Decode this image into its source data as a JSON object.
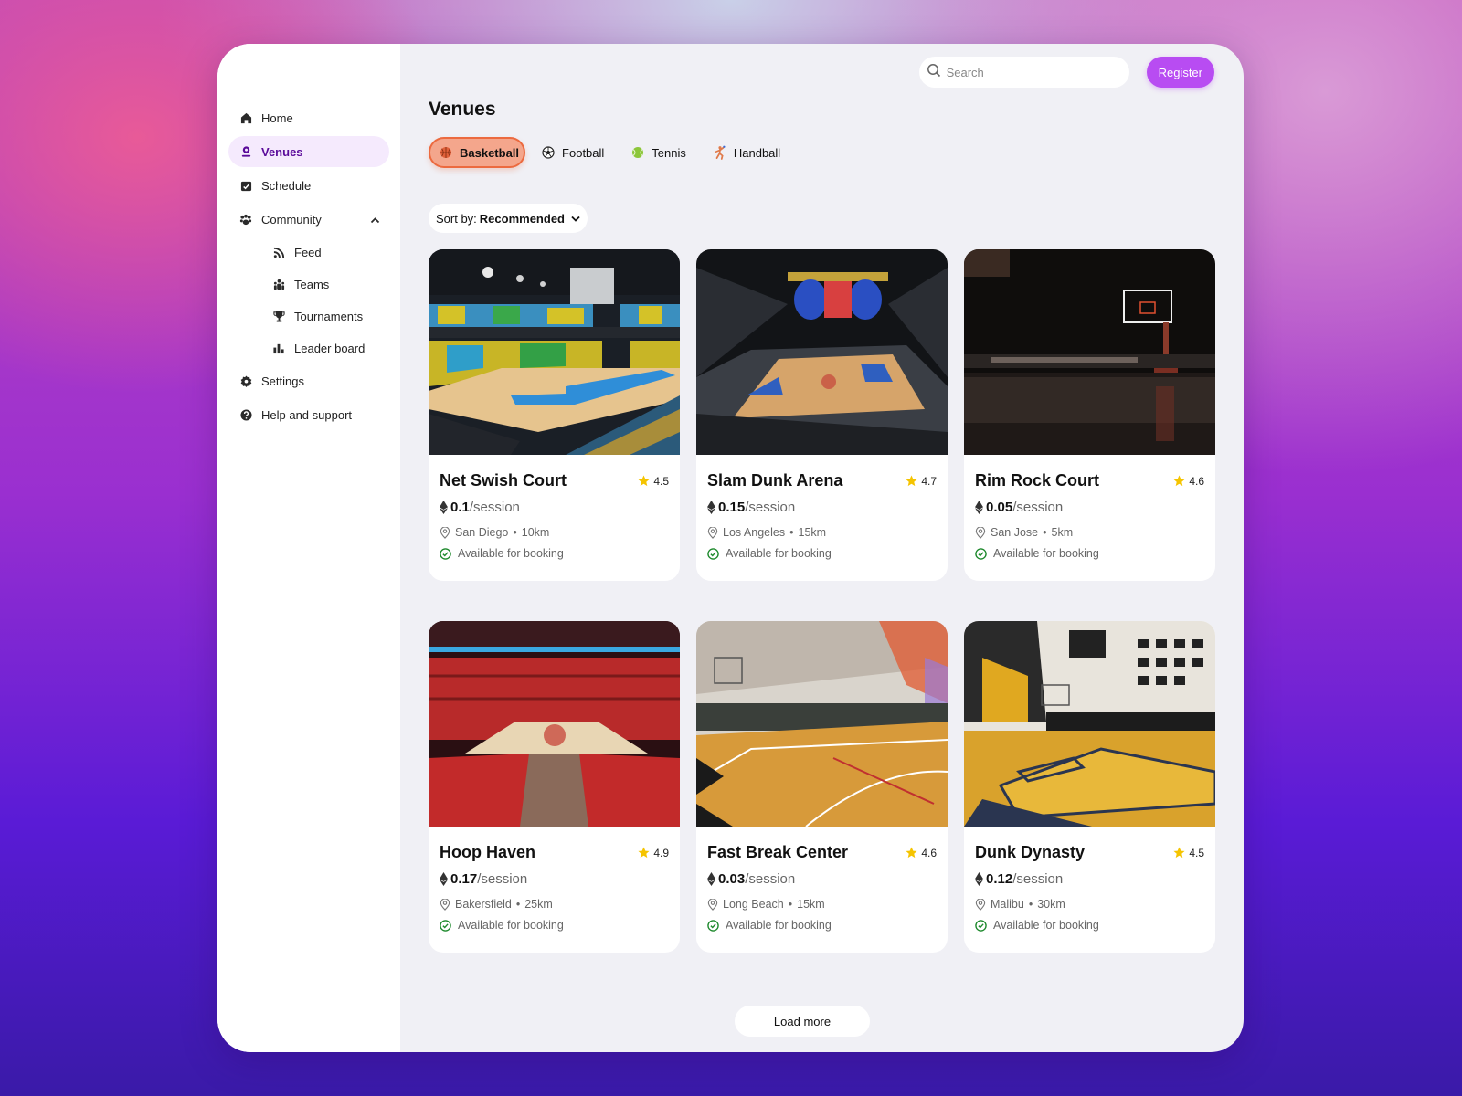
{
  "sidebar": {
    "items": [
      {
        "label": "Home",
        "icon": "home-icon",
        "active": false
      },
      {
        "label": "Venues",
        "icon": "venue-pin-icon",
        "active": true
      },
      {
        "label": "Schedule",
        "icon": "calendar-check-icon",
        "active": false
      },
      {
        "label": "Community",
        "icon": "community-icon",
        "active": false,
        "expanded": true
      }
    ],
    "community_subitems": [
      {
        "label": "Feed",
        "icon": "rss-icon"
      },
      {
        "label": "Teams",
        "icon": "teams-icon"
      },
      {
        "label": "Tournaments",
        "icon": "trophy-icon"
      },
      {
        "label": "Leader board",
        "icon": "bar-chart-icon"
      }
    ],
    "bottom_items": [
      {
        "label": "Settings",
        "icon": "gear-icon"
      },
      {
        "label": "Help and support",
        "icon": "help-icon"
      }
    ]
  },
  "topbar": {
    "search_placeholder": "Search",
    "search_value": "",
    "register_label": "Register"
  },
  "page": {
    "title": "Venues",
    "tabs": [
      {
        "label": "Basketball",
        "icon": "basketball-icon",
        "active": true
      },
      {
        "label": "Football",
        "icon": "football-icon",
        "active": false
      },
      {
        "label": "Tennis",
        "icon": "tennis-ball-icon",
        "active": false
      },
      {
        "label": "Handball",
        "icon": "handball-player-icon",
        "active": false
      }
    ],
    "sort": {
      "prefix": "Sort by:",
      "value": "Recommended"
    },
    "load_more_label": "Load more",
    "price_suffix": "/session"
  },
  "venues": [
    {
      "name": "Net Swish Court",
      "rating": "4.5",
      "price": "0.1",
      "city": "San Diego",
      "distance": "10km",
      "status": "Available for booking"
    },
    {
      "name": "Slam Dunk Arena",
      "rating": "4.7",
      "price": "0.15",
      "city": "Los Angeles",
      "distance": "15km",
      "status": "Available for booking"
    },
    {
      "name": "Rim Rock Court",
      "rating": "4.6",
      "price": "0.05",
      "city": "San Jose",
      "distance": "5km",
      "status": "Available for booking"
    },
    {
      "name": "Hoop Haven",
      "rating": "4.9",
      "price": "0.17",
      "city": "Bakersfield",
      "distance": "25km",
      "status": "Available for booking"
    },
    {
      "name": "Fast Break Center",
      "rating": "4.6",
      "price": "0.03",
      "city": "Long Beach",
      "distance": "15km",
      "status": "Available for booking"
    },
    {
      "name": "Dunk Dynasty",
      "rating": "4.5",
      "price": "0.12",
      "city": "Malibu",
      "distance": "30km",
      "status": "Available for booking"
    }
  ],
  "colors": {
    "accent": "#b84cf2",
    "active_nav_bg": "#f5eafd",
    "active_nav_text": "#5a0b9a",
    "active_tab_bg": "#f4a68c",
    "active_tab_border": "#ec6a3f",
    "star": "#f5c400",
    "available": "#1f8a2e"
  }
}
